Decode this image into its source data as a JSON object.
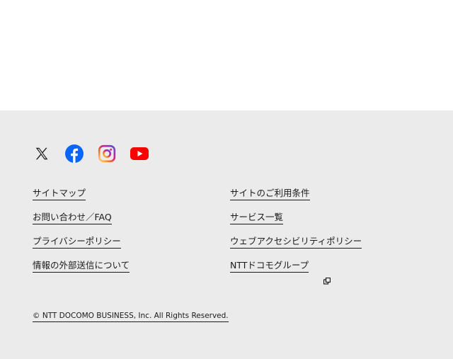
{
  "social": [
    {
      "name": "x-icon",
      "color": "#1a1a1a"
    },
    {
      "name": "facebook-icon",
      "color": "#0866ff"
    },
    {
      "name": "instagram-icon",
      "color": "#d62976"
    },
    {
      "name": "youtube-icon",
      "color": "#ff0000"
    }
  ],
  "links": {
    "left": [
      "サイトマップ",
      "お問い合わせ／FAQ",
      "プライバシーポリシー",
      "情報の外部送信について"
    ],
    "right": [
      "サイトのご利用条件",
      "サービス一覧",
      "ウェブアクセシビリティポリシー",
      "NTTドコモグループ"
    ]
  },
  "external_link_icon": "external-link-icon",
  "copyright": "© NTT DOCOMO BUSINESS, Inc. All Rights Reserved.",
  "colors": {
    "footer_bg": "#ebebeb",
    "text": "#1a1a1a"
  }
}
